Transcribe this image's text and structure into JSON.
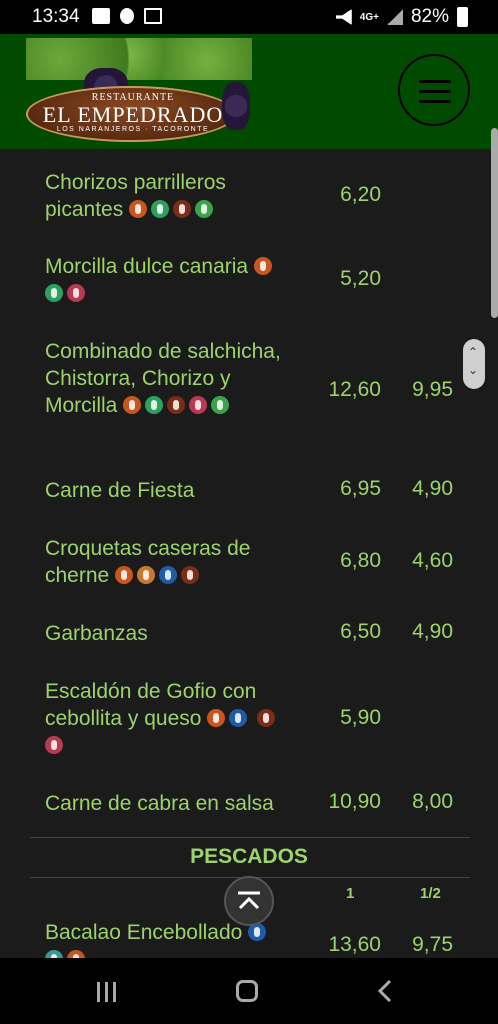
{
  "status_bar": {
    "time": "13:34",
    "network": "4G+",
    "battery": "82%"
  },
  "restaurant": {
    "line1": "RESTAURANTE",
    "name": "EL EMPEDRADO",
    "line3": "LOS NARANJEROS · TACORONTE"
  },
  "items": [
    {
      "name": "Chorizos parrilleros picantes",
      "price1": "6,20",
      "price2": "",
      "allergens": [
        "orange",
        "green",
        "brown",
        "leaf"
      ]
    },
    {
      "name": "Morcilla dulce canaria",
      "price1": "5,20",
      "price2": "",
      "allergens": [
        "orange",
        "green",
        "pink"
      ]
    },
    {
      "name": "Combinado de salchicha, Chistorra, Chorizo y Morcilla",
      "price1": "12,60",
      "price2": "9,95",
      "allergens": [
        "orange",
        "green",
        "brown",
        "pink",
        "leaf"
      ]
    },
    {
      "name": "Carne de Fiesta",
      "price1": "6,95",
      "price2": "4,90",
      "allergens": []
    },
    {
      "name": "Croquetas caseras de cherne",
      "price1": "6,80",
      "price2": "4,60",
      "allergens": [
        "orange",
        "tan",
        "blue",
        "brown"
      ]
    },
    {
      "name": "Garbanzas",
      "price1": "6,50",
      "price2": "4,90",
      "allergens": []
    },
    {
      "name": "Escaldón de Gofio con cebollita y queso",
      "price1": "5,90",
      "price2": "",
      "allergens": [
        "orange",
        "blue",
        "brown",
        "pink"
      ]
    },
    {
      "name": "Carne de cabra en salsa",
      "price1": "10,90",
      "price2": "8,00",
      "allergens": []
    }
  ],
  "pescados": {
    "title": "PESCADOS",
    "col1": "1",
    "col2": "1/2",
    "first_item": {
      "name": "Bacalao Encebollado",
      "price1": "13,60",
      "price2": "9,75"
    }
  },
  "icons": {
    "menu": "hamburger-menu-icon",
    "scroll_top": "chevron-up-icon"
  }
}
